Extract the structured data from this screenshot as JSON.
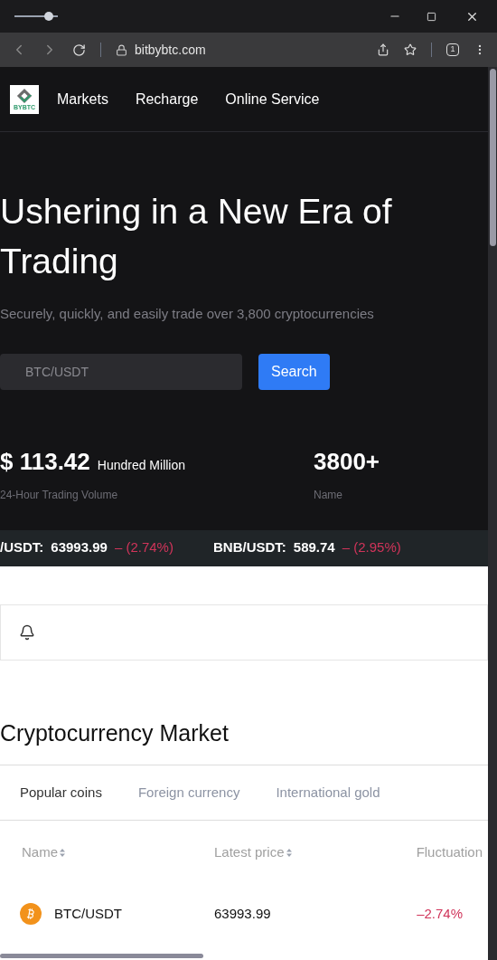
{
  "browser": {
    "url": "bitbybtc.com",
    "tab_count": "1",
    "zoom": {
      "level": 0.8
    }
  },
  "logo": {
    "text": "BYBTC"
  },
  "nav": [
    {
      "label": "Markets"
    },
    {
      "label": "Recharge"
    },
    {
      "label": "Online Service"
    }
  ],
  "hero": {
    "title": "Ushering in a New Era of Trading",
    "subtitle": "Securely, quickly, and easily trade over 3,800 cryptocurrencies"
  },
  "search": {
    "placeholder": "BTC/USDT",
    "button": "Search"
  },
  "stats": [
    {
      "value": "$ 113.42",
      "unit": "Hundred Million",
      "label": "24-Hour Trading Volume"
    },
    {
      "value": "3800+",
      "label": "Name"
    }
  ],
  "ticker": [
    {
      "pair": "/USDT:",
      "price": "63993.99",
      "change": "– (2.74%)"
    },
    {
      "pair": "BNB/USDT:",
      "price": "589.74",
      "change": "– (2.95%)"
    }
  ],
  "market": {
    "title": "Cryptocurrency Market",
    "tabs": [
      {
        "label": "Popular coins",
        "selected": true
      },
      {
        "label": "Foreign currency",
        "selected": false
      },
      {
        "label": "International gold",
        "selected": false
      }
    ],
    "columns": [
      {
        "label": "Name",
        "sortable": true
      },
      {
        "label": "Latest price",
        "sortable": true
      },
      {
        "label": "Fluctuation",
        "sortable": false
      }
    ],
    "rows": [
      {
        "pair": "BTC/USDT",
        "price": "63993.99",
        "change": "–2.74%"
      }
    ]
  }
}
